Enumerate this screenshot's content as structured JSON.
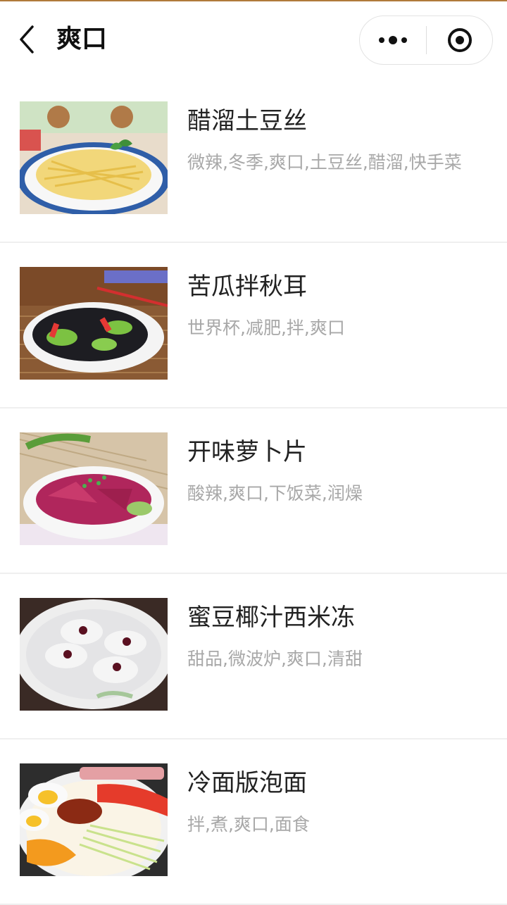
{
  "header": {
    "title": "爽口",
    "back_icon": "chevron-left-icon",
    "more_icon": "more-dots-icon",
    "close_icon": "target-close-icon"
  },
  "recipes": [
    {
      "title": "醋溜土豆丝",
      "tags": "微辣,冬季,爽口,土豆丝,醋溜,快手菜"
    },
    {
      "title": "苦瓜拌秋耳",
      "tags": "世界杯,减肥,拌,爽口"
    },
    {
      "title": "开味萝卜片",
      "tags": "酸辣,爽口,下饭菜,润燥"
    },
    {
      "title": "蜜豆椰汁西米冻",
      "tags": "甜品,微波炉,爽口,清甜"
    },
    {
      "title": "冷面版泡面",
      "tags": "拌,煮,爽口,面食"
    }
  ],
  "colors": {
    "accent_line": "#b07a3a",
    "title_text": "#222222",
    "tag_text": "#a8a8a8"
  }
}
